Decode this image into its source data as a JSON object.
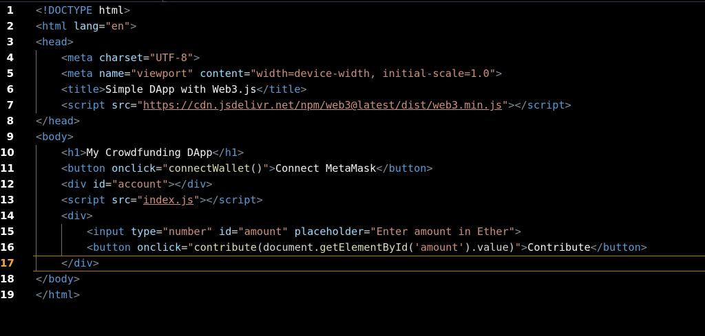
{
  "editor": {
    "theme": {
      "background": "#000000",
      "tag": "#569cd6",
      "attribute": "#9cdcfe",
      "string": "#ce9178",
      "text": "#f2f2f2",
      "active_line_number": "#f2a53a"
    },
    "active_line": 17,
    "line_numbers": [
      "1",
      "2",
      "3",
      "4",
      "5",
      "6",
      "7",
      "8",
      "9",
      "10",
      "11",
      "12",
      "13",
      "14",
      "15",
      "16",
      "17",
      "18",
      "19"
    ],
    "lines": [
      {
        "p1": "<",
        "t1": "!DOCTYPE",
        "rest": " html",
        "p2": ">"
      },
      {
        "p1": "<",
        "t1": "html",
        "a1": " lang",
        "eq1": "=",
        "s1": "\"en\"",
        "p2": ">"
      },
      {
        "p1": "<",
        "t1": "head",
        "p2": ">"
      },
      {
        "p1": "<",
        "t1": "meta",
        "a1": " charset",
        "eq1": "=",
        "s1": "\"UTF-8\"",
        "p2": ">"
      },
      {
        "p1": "<",
        "t1": "meta",
        "a1": " name",
        "eq1": "=",
        "s1": "\"viewport\"",
        "a2": " content",
        "eq2": "=",
        "s2": "\"width=device-width, initial-scale=1.0\"",
        "p2": ">"
      },
      {
        "p1": "<",
        "t1": "title",
        "p2": ">",
        "text": "Simple DApp with Web3.js",
        "p3": "</",
        "t2": "title",
        "p4": ">"
      },
      {
        "p1": "<",
        "t1": "script",
        "a1": " src",
        "eq1": "=",
        "q1": "\"",
        "s1": "https://cdn.jsdelivr.net/npm/web3@latest/dist/web3.min.js",
        "q2": "\"",
        "p2": ">",
        "p3": "</",
        "t2": "script",
        "p4": ">"
      },
      {
        "p1": "</",
        "t1": "head",
        "p2": ">"
      },
      {
        "p1": "<",
        "t1": "body",
        "p2": ">"
      },
      {
        "p1": "<",
        "t1": "h1",
        "p2": ">",
        "text": "My Crowdfunding DApp",
        "p3": "</",
        "t2": "h1",
        "p4": ">"
      },
      {
        "p1": "<",
        "t1": "button",
        "a1": " onclick",
        "eq1": "=",
        "q1": "\"",
        "f1": "connectWallet",
        "f2": "()",
        "q2": "\"",
        "p2": ">",
        "text": "Connect MetaMask",
        "p3": "</",
        "t2": "button",
        "p4": ">"
      },
      {
        "p1": "<",
        "t1": "div",
        "a1": " id",
        "eq1": "=",
        "s1": "\"account\"",
        "p2": ">",
        "p3": "</",
        "t2": "div",
        "p4": ">"
      },
      {
        "p1": "<",
        "t1": "script",
        "a1": " src",
        "eq1": "=",
        "q1": "\"",
        "s1": "index.js",
        "q2": "\"",
        "p2": ">",
        "p3": "</",
        "t2": "script",
        "p4": ">"
      },
      {
        "p1": "<",
        "t1": "div",
        "p2": ">"
      },
      {
        "p1": "<",
        "t1": "input",
        "a1": " type",
        "eq1": "=",
        "s1": "\"number\"",
        "a2": " id",
        "eq2": "=",
        "s2": "\"amount\"",
        "a3": " placeholder",
        "eq3": "=",
        "s3": "\"Enter amount in Ether\"",
        "p2": ">"
      },
      {
        "p1": "<",
        "t1": "button",
        "a1": " onclick",
        "eq1": "=",
        "q1": "\"",
        "f1": "contribute",
        "c1": "(document.",
        "f2": "getElementById",
        "c2": "(",
        "s1": "'amount'",
        "c3": ").value)",
        "q2": "\"",
        "p2": ">",
        "text": "Contribute",
        "p3": "</",
        "t2": "button",
        "p4": ">"
      },
      {
        "p1": "</",
        "t1": "div",
        "p2": ">"
      },
      {
        "p1": "</",
        "t1": "body",
        "p2": ">"
      },
      {
        "p1": "</",
        "t1": "html",
        "p2": ">"
      }
    ]
  }
}
